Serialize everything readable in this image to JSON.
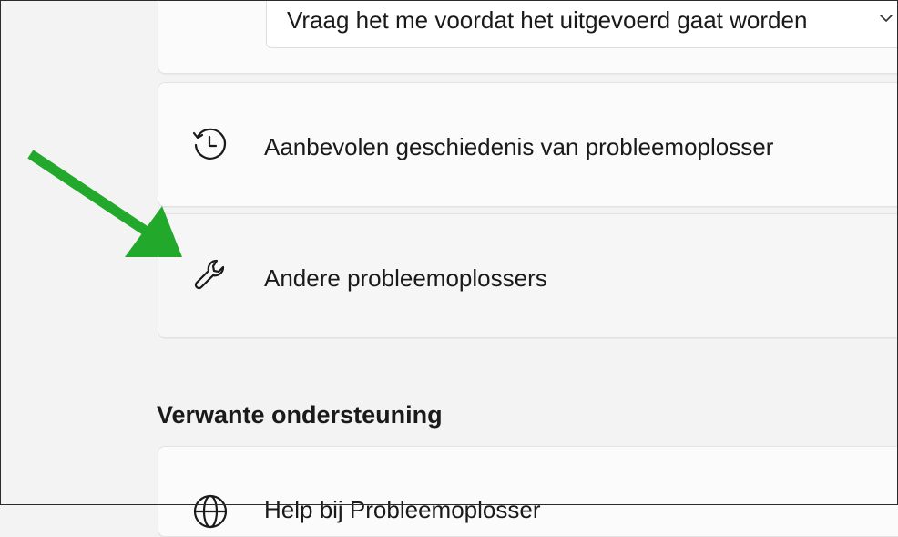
{
  "dropdown": {
    "selected_value": "Vraag het me voordat het uitgevoerd gaat worden",
    "icon": "chevron-down-icon"
  },
  "rows": {
    "history": {
      "label": "Aanbevolen geschiedenis van probleemoplosser",
      "icon": "history-icon"
    },
    "other_troubleshooters": {
      "label": "Andere probleemoplossers",
      "icon": "wrench-icon"
    },
    "help": {
      "label": "Help bij Probleemoplosser",
      "icon": "globe-icon"
    }
  },
  "related_support": {
    "title": "Verwante ondersteuning"
  },
  "annotation": {
    "arrow_color": "#22a82a"
  }
}
